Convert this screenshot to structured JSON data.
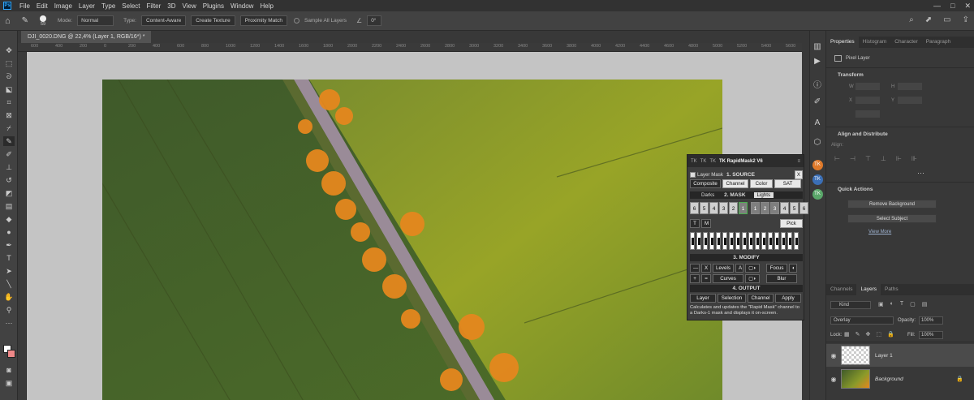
{
  "menu": {
    "logo": "Ps",
    "items": [
      "File",
      "Edit",
      "Image",
      "Layer",
      "Type",
      "Select",
      "Filter",
      "3D",
      "View",
      "Plugins",
      "Window",
      "Help"
    ],
    "window_controls": [
      "—",
      "□",
      "✕"
    ]
  },
  "options": {
    "brush_size": "59",
    "mode_label": "Mode:",
    "mode_value": "Normal",
    "type_label": "Type:",
    "type_buttons": [
      "Content-Aware",
      "Create Texture",
      "Proximity Match"
    ],
    "sample_label": "Sample All Layers",
    "angle": "0°"
  },
  "document": {
    "tab_title": "DJI_0020.DNG @ 22,4% (Layer 1, RGB/16*) *",
    "ruler_ticks": [
      "600",
      "400",
      "200",
      "0",
      "200",
      "400",
      "600",
      "800",
      "1000",
      "1200",
      "1400",
      "1600",
      "1800",
      "2000",
      "2200",
      "2400",
      "2600",
      "2800",
      "3000",
      "3200",
      "3400",
      "3600",
      "3800",
      "4000",
      "4200",
      "4400",
      "4600",
      "4800",
      "5000",
      "5200",
      "5400",
      "5600"
    ]
  },
  "rapidmask": {
    "tabs": [
      "TK",
      "TK",
      "TK"
    ],
    "title": "TK RapidMask2 V6",
    "layer_mask": "Layer Mask",
    "section1": "1. SOURCE",
    "source_buttons": [
      "Composite",
      "Channel",
      "Color",
      "SAT"
    ],
    "close": "X",
    "section2_left": "Darks",
    "section2": "2. MASK",
    "section2_right": "Lights",
    "dark_nums": [
      "6",
      "5",
      "4",
      "3",
      "2",
      "1"
    ],
    "light_nums": [
      "1",
      "2",
      "3",
      "4",
      "5",
      "6"
    ],
    "t_label": "T",
    "m_label": "M",
    "pick": "Pick",
    "section3": "3. MODIFY",
    "minus": "—",
    "x": "X",
    "levels": "Levels",
    "a": "A",
    "focus": "Focus",
    "plus": "+",
    "equals": "=",
    "curves": "Curves",
    "blur": "Blur",
    "section4": "4. OUTPUT",
    "output_buttons": [
      "Layer",
      "Selection",
      "Channel",
      "Apply"
    ],
    "description": "Calculates and updates the \"Rapid Mask\" channel to a Darks-1 mask and displays it on-screen."
  },
  "properties": {
    "tabs": [
      "Properties",
      "Histogram",
      "Character",
      "Paragraph"
    ],
    "pixel_layer": "Pixel Layer",
    "transform": "Transform",
    "w": "W",
    "h": "H",
    "x": "X",
    "y": "Y",
    "align_distribute": "Align and Distribute",
    "align_label": "Align:",
    "quick_actions": "Quick Actions",
    "remove_bg": "Remove Background",
    "select_subject": "Select Subject",
    "view_more": "View More"
  },
  "layers": {
    "tabs": [
      "Channels",
      "Layers",
      "Paths"
    ],
    "kind": "Kind",
    "blend_mode": "Overlay",
    "opacity_label": "Opacity:",
    "opacity": "100%",
    "lock_label": "Lock:",
    "fill_label": "Fill:",
    "fill": "100%",
    "items": [
      {
        "name": "Layer 1"
      },
      {
        "name": "Background"
      }
    ]
  },
  "colors": {
    "accent_blue": "#31a8ff",
    "tk_orange": "#e07a2a",
    "field_green": "#6c8a22",
    "tree_orange": "#e5871e"
  }
}
